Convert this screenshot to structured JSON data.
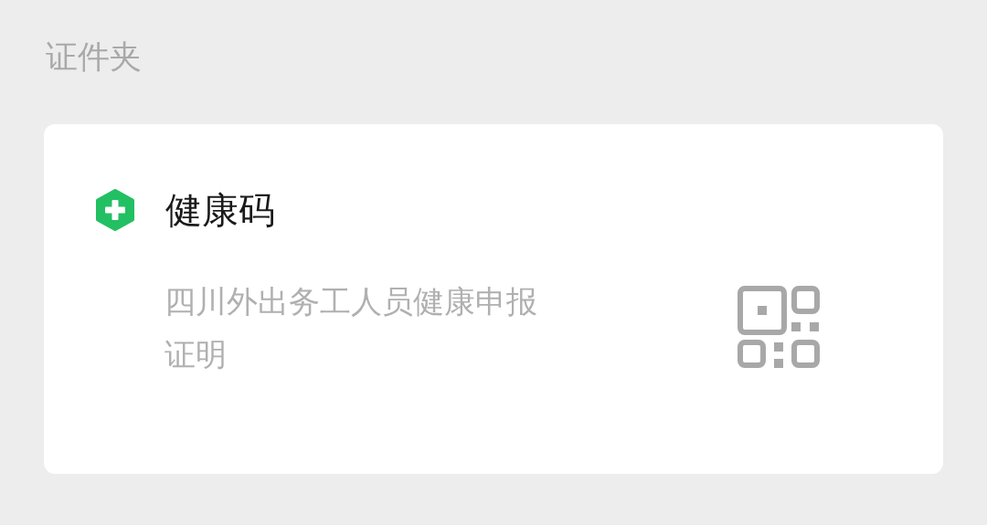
{
  "section_title": "证件夹",
  "card": {
    "title": "健康码",
    "description": "四川外出务工人员健康申报证明"
  }
}
